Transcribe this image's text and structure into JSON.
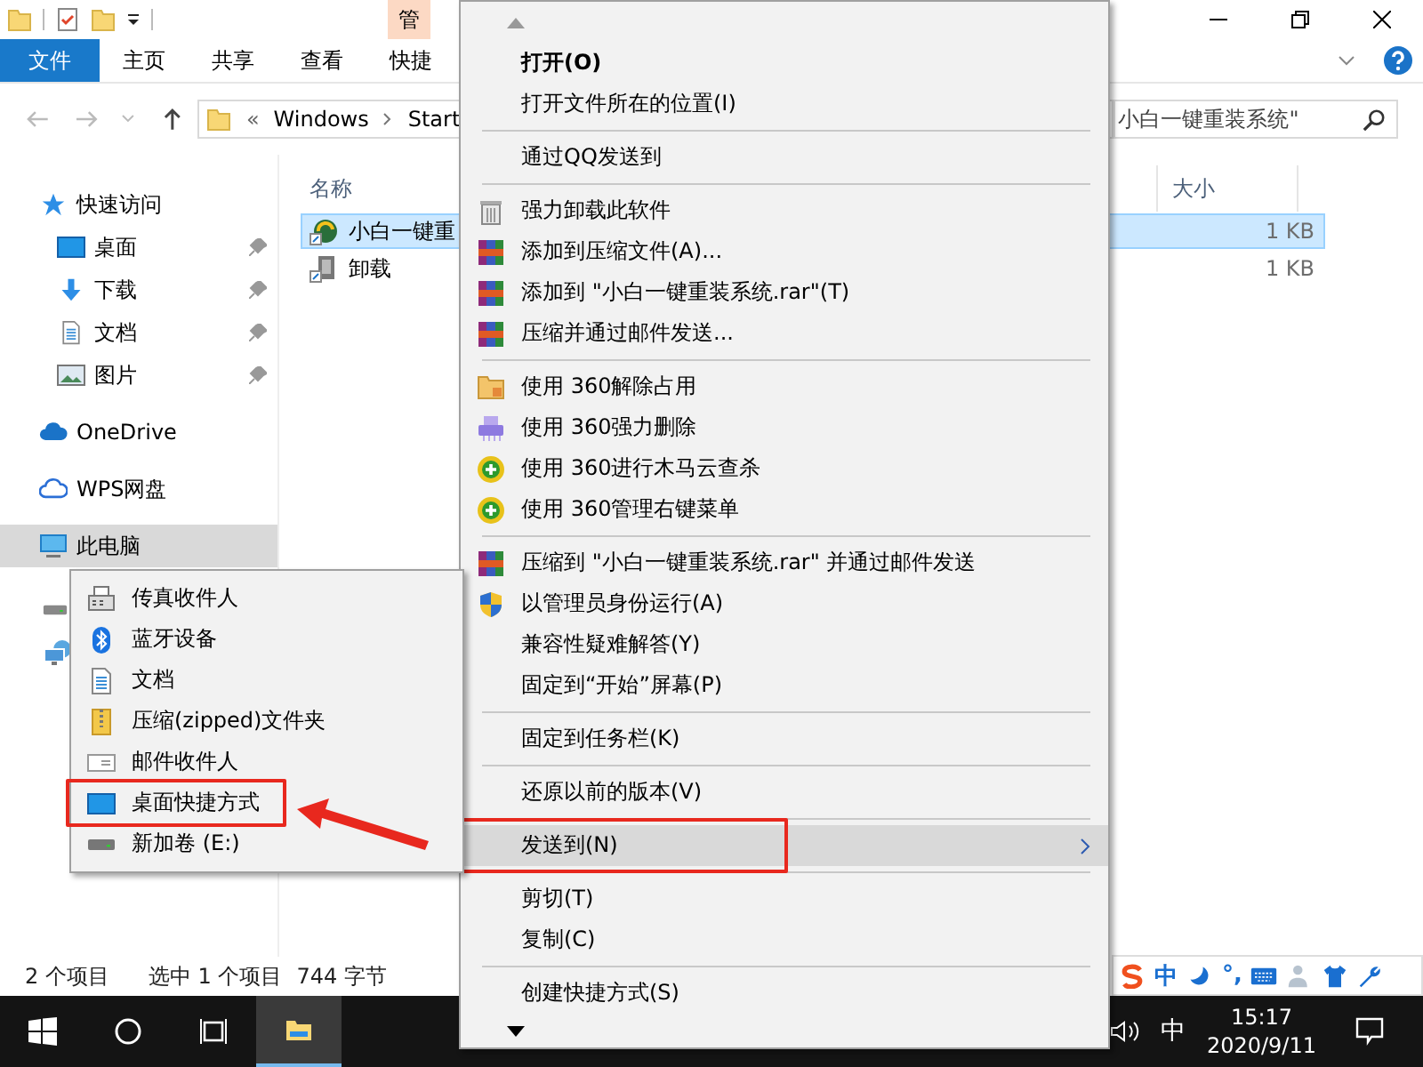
{
  "title_bar": {
    "context_tab": "管"
  },
  "ribbon_tabs": [
    {
      "label": "文件",
      "kind": "file",
      "selected": false
    },
    {
      "label": "主页",
      "kind": "tab",
      "selected": false
    },
    {
      "label": "共享",
      "kind": "tab",
      "selected": false
    },
    {
      "label": "查看",
      "kind": "tab",
      "selected": false
    },
    {
      "label": "快捷",
      "kind": "tab",
      "selected": false
    }
  ],
  "address": {
    "overflow": "«",
    "path": [
      "Windows",
      "Start"
    ]
  },
  "search": {
    "value": "小白一键重装系统\""
  },
  "sidebar": [
    {
      "label": "快速访问",
      "kind": "quick",
      "selected": false,
      "children": [
        {
          "label": "桌面",
          "kind": "desktop",
          "pinned": true,
          "selected": false
        },
        {
          "label": "下载",
          "kind": "download",
          "pinned": true,
          "selected": false
        },
        {
          "label": "文档",
          "kind": "doc",
          "pinned": true,
          "selected": false
        },
        {
          "label": "图片",
          "kind": "picture",
          "pinned": true,
          "selected": false
        }
      ]
    },
    {
      "label": "OneDrive",
      "kind": "cloud",
      "selected": false
    },
    {
      "label": "WPS网盘",
      "kind": "wps",
      "selected": false
    },
    {
      "label": "此电脑",
      "kind": "pc",
      "selected": true
    }
  ],
  "columns": [
    "名称",
    "大小"
  ],
  "files": [
    {
      "name": "小白一键重",
      "size": "1 KB",
      "selected": true
    },
    {
      "name": "卸载",
      "size": "1 KB",
      "selected": false
    }
  ],
  "status_bar": {
    "item_count": "2 个项目",
    "selection": "选中 1 个项目",
    "selection_size": "744 字节"
  },
  "context_menu": {
    "items": [
      {
        "kind": "item",
        "label": "打开(O)",
        "default": true,
        "selected": false,
        "submenu": false,
        "annotated": false
      },
      {
        "kind": "item",
        "label": "打开文件所在的位置(I)",
        "default": false,
        "selected": false,
        "submenu": false,
        "annotated": false
      },
      {
        "kind": "separator"
      },
      {
        "kind": "item",
        "label": "通过QQ发送到",
        "default": false,
        "selected": false,
        "submenu": false,
        "annotated": false
      },
      {
        "kind": "separator"
      },
      {
        "kind": "item",
        "label": "强力卸载此软件",
        "default": false,
        "selected": false,
        "submenu": false,
        "annotated": false
      },
      {
        "kind": "item",
        "label": "添加到压缩文件(A)...",
        "default": false,
        "selected": false,
        "submenu": false,
        "annotated": false
      },
      {
        "kind": "item",
        "label": "添加到 \"小白一键重装系统.rar\"(T)",
        "default": false,
        "selected": false,
        "submenu": false,
        "annotated": false
      },
      {
        "kind": "item",
        "label": "压缩并通过邮件发送...",
        "default": false,
        "selected": false,
        "submenu": false,
        "annotated": false
      },
      {
        "kind": "separator"
      },
      {
        "kind": "item",
        "label": "使用 360解除占用",
        "default": false,
        "selected": false,
        "submenu": false,
        "annotated": false
      },
      {
        "kind": "item",
        "label": "使用 360强力删除",
        "default": false,
        "selected": false,
        "submenu": false,
        "annotated": false
      },
      {
        "kind": "item",
        "label": "使用 360进行木马云查杀",
        "default": false,
        "selected": false,
        "submenu": false,
        "annotated": false
      },
      {
        "kind": "item",
        "label": "使用 360管理右键菜单",
        "default": false,
        "selected": false,
        "submenu": false,
        "annotated": false
      },
      {
        "kind": "separator"
      },
      {
        "kind": "item",
        "label": "压缩到 \"小白一键重装系统.rar\" 并通过邮件发送",
        "default": false,
        "selected": false,
        "submenu": false,
        "annotated": false
      },
      {
        "kind": "item",
        "label": "以管理员身份运行(A)",
        "default": false,
        "selected": false,
        "submenu": false,
        "annotated": false
      },
      {
        "kind": "item",
        "label": "兼容性疑难解答(Y)",
        "default": false,
        "selected": false,
        "submenu": false,
        "annotated": false
      },
      {
        "kind": "item",
        "label": "固定到“开始”屏幕(P)",
        "default": false,
        "selected": false,
        "submenu": false,
        "annotated": false
      },
      {
        "kind": "separator"
      },
      {
        "kind": "item",
        "label": "固定到任务栏(K)",
        "default": false,
        "selected": false,
        "submenu": false,
        "annotated": false
      },
      {
        "kind": "separator"
      },
      {
        "kind": "item",
        "label": "还原以前的版本(V)",
        "default": false,
        "selected": false,
        "submenu": false,
        "annotated": false
      },
      {
        "kind": "separator"
      },
      {
        "kind": "item",
        "label": "发送到(N)",
        "default": false,
        "selected": true,
        "submenu": true,
        "annotated": true
      },
      {
        "kind": "separator"
      },
      {
        "kind": "item",
        "label": "剪切(T)",
        "default": false,
        "selected": false,
        "submenu": false,
        "annotated": false
      },
      {
        "kind": "item",
        "label": "复制(C)",
        "default": false,
        "selected": false,
        "submenu": false,
        "annotated": false
      },
      {
        "kind": "separator"
      },
      {
        "kind": "item",
        "label": "创建快捷方式(S)",
        "default": false,
        "selected": false,
        "submenu": false,
        "annotated": false
      }
    ]
  },
  "send_to_menu": {
    "items": [
      {
        "label": "传真收件人",
        "annotated": false
      },
      {
        "label": "蓝牙设备",
        "annotated": false
      },
      {
        "label": "文档",
        "annotated": false
      },
      {
        "label": "压缩(zipped)文件夹",
        "annotated": false
      },
      {
        "label": "邮件收件人",
        "annotated": false
      },
      {
        "label": "桌面快捷方式",
        "annotated": true
      },
      {
        "label": "新加卷 (E:)",
        "annotated": false
      }
    ]
  },
  "ime_bar": {
    "mode": "中",
    "punctuation": "°,"
  },
  "taskbar": {
    "input_method": "中",
    "time": "15:17",
    "date": "2020/9/11"
  }
}
